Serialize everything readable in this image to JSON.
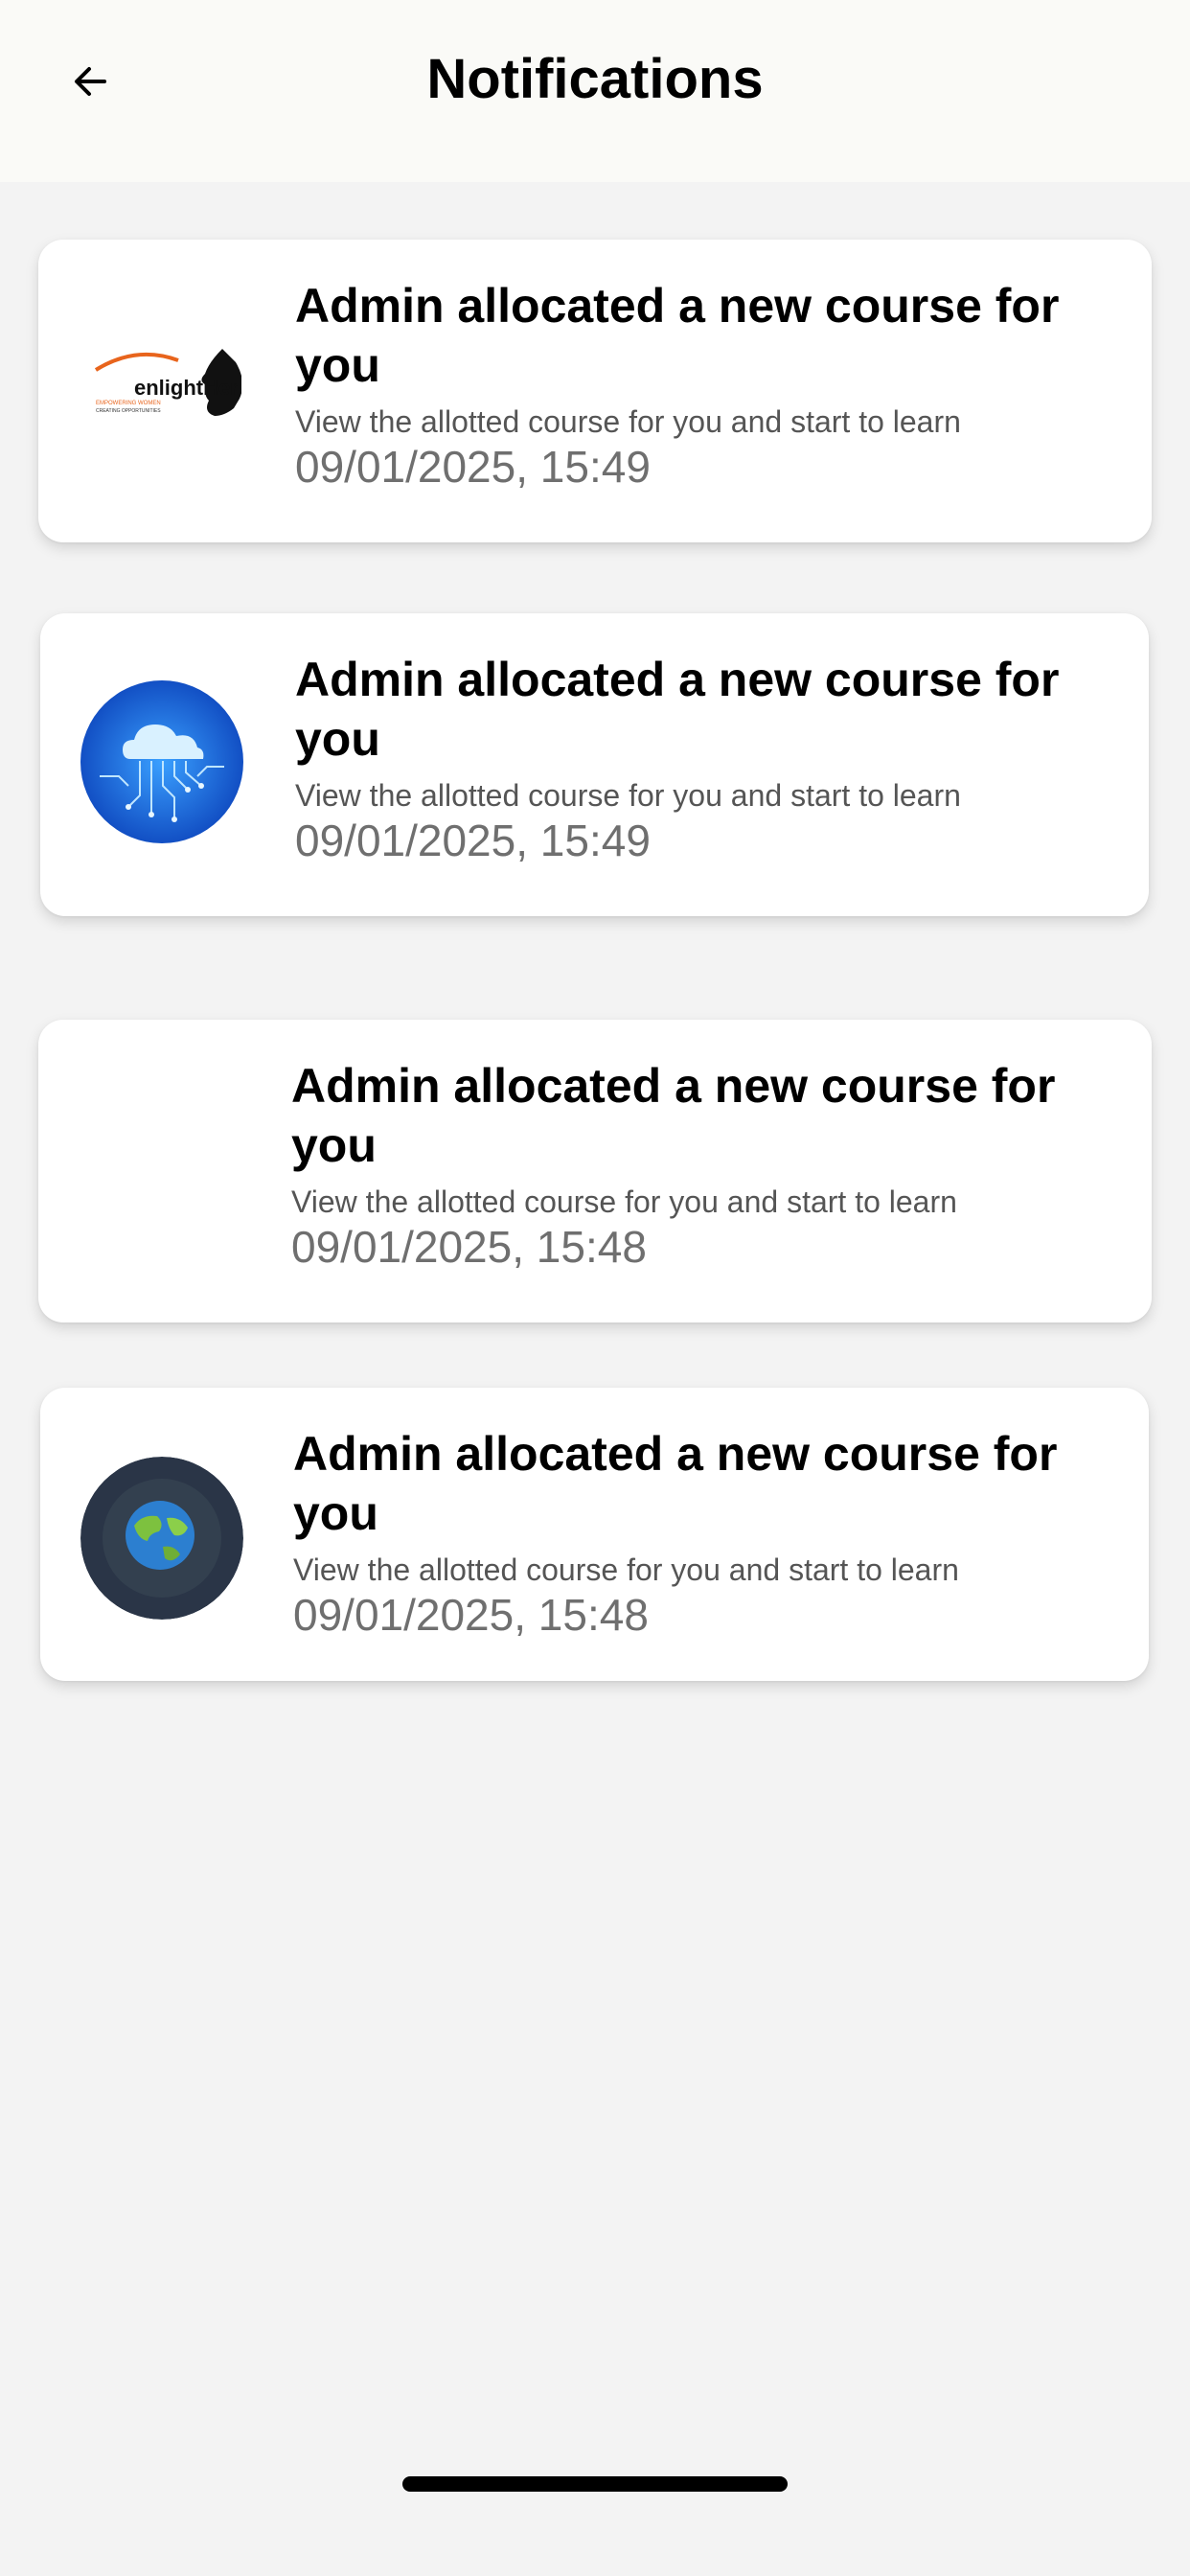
{
  "header": {
    "title": "Notifications",
    "back_icon": "arrow-left-icon"
  },
  "notifications": [
    {
      "title": "Admin allocated a new course for you",
      "description": "View the allotted course for you and start to learn",
      "timestamp": "09/01/2025, 15:49",
      "thumbnail": "enlighther-logo",
      "logo_text": "enlightHer",
      "logo_tagline": "EMPOWERING WOMEN",
      "logo_subtagline": "CREATING OPPORTUNITIES"
    },
    {
      "title": "Admin allocated a new course for you",
      "description": "View the allotted course for you and start to learn",
      "timestamp": "09/01/2025, 15:49",
      "thumbnail": "cloud-circuit-image"
    },
    {
      "title": "Admin allocated a new course for you",
      "description": "View the allotted course for you and start to learn",
      "timestamp": "09/01/2025, 15:48",
      "thumbnail": ""
    },
    {
      "title": "Admin allocated a new course for you",
      "description": "View the allotted course for you and start to learn",
      "timestamp": "09/01/2025, 15:48",
      "thumbnail": "globe-image"
    }
  ],
  "colors": {
    "background": "#f3f3f3",
    "header_background": "#fafaf7",
    "card_background": "#ffffff",
    "title_text": "#000000",
    "description_text": "#555555",
    "date_text": "#6f6f6f",
    "logo_orange": "#e8641c"
  }
}
